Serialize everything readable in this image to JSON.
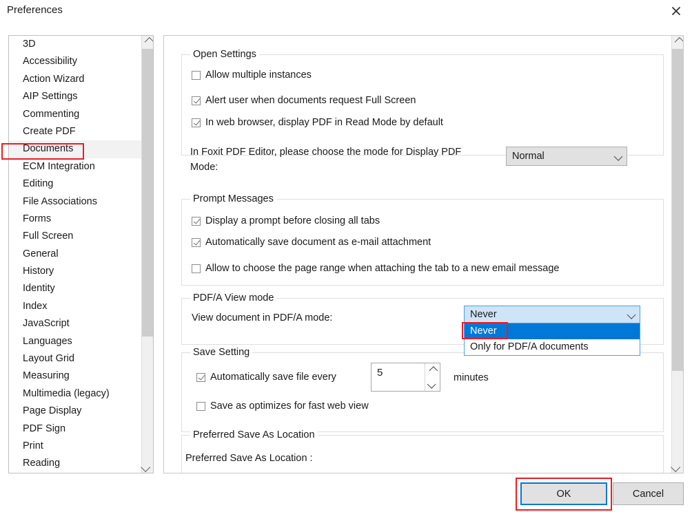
{
  "window": {
    "title": "Preferences",
    "close_icon": "close-icon"
  },
  "sidebar": {
    "items": [
      {
        "label": "3D",
        "selected": false
      },
      {
        "label": "Accessibility",
        "selected": false
      },
      {
        "label": "Action Wizard",
        "selected": false
      },
      {
        "label": "AIP Settings",
        "selected": false
      },
      {
        "label": "Commenting",
        "selected": false
      },
      {
        "label": "Create PDF",
        "selected": false
      },
      {
        "label": "Documents",
        "selected": true
      },
      {
        "label": "ECM Integration",
        "selected": false
      },
      {
        "label": "Editing",
        "selected": false
      },
      {
        "label": "File Associations",
        "selected": false
      },
      {
        "label": "Forms",
        "selected": false
      },
      {
        "label": "Full Screen",
        "selected": false
      },
      {
        "label": "General",
        "selected": false
      },
      {
        "label": "History",
        "selected": false
      },
      {
        "label": "Identity",
        "selected": false
      },
      {
        "label": "Index",
        "selected": false
      },
      {
        "label": "JavaScript",
        "selected": false
      },
      {
        "label": "Languages",
        "selected": false
      },
      {
        "label": "Layout Grid",
        "selected": false
      },
      {
        "label": "Measuring",
        "selected": false
      },
      {
        "label": "Multimedia (legacy)",
        "selected": false
      },
      {
        "label": "Page Display",
        "selected": false
      },
      {
        "label": "PDF Sign",
        "selected": false
      },
      {
        "label": "Print",
        "selected": false
      },
      {
        "label": "Reading",
        "selected": false
      }
    ],
    "scroll_up_icon": "chevron-up-icon",
    "scroll_down_icon": "chevron-down-icon"
  },
  "open_settings": {
    "legend": "Open Settings",
    "allow_multiple_instances": {
      "label": "Allow multiple instances",
      "checked": false
    },
    "alert_full_screen": {
      "label": "Alert user when documents request Full Screen",
      "checked": true
    },
    "read_mode_default": {
      "label": "In web browser, display PDF in Read Mode by default",
      "checked": true
    },
    "display_mode_label": "In Foxit PDF Editor, please choose the mode for Display PDF Mode:",
    "display_mode_value": "Normal",
    "display_mode_arrow_icon": "chevron-down-icon"
  },
  "prompt_messages": {
    "legend": "Prompt Messages",
    "closing_all_tabs": {
      "label": "Display a prompt before closing all tabs",
      "checked": true
    },
    "save_as_email_attachment": {
      "label": "Automatically save document as e-mail attachment",
      "checked": true
    },
    "choose_page_range": {
      "label": "Allow to choose the page range when attaching the tab to a new email message",
      "checked": false
    }
  },
  "pdfa_view_mode": {
    "legend": "PDF/A View mode",
    "label": "View document in PDF/A mode:",
    "value": "Never",
    "arrow_icon": "chevron-down-icon",
    "expanded": true,
    "options": [
      {
        "label": "Never",
        "selected": true
      },
      {
        "label": "Only for PDF/A documents",
        "selected": false
      }
    ]
  },
  "save_setting": {
    "legend": "Save Setting",
    "auto_save": {
      "label": "Automatically save file every",
      "checked": true
    },
    "interval_value": "5",
    "interval_unit": "minutes",
    "spinner_up_icon": "chevron-up-icon",
    "spinner_down_icon": "chevron-down-icon",
    "fast_web_view": {
      "label": "Save as optimizes for fast web view",
      "checked": false
    }
  },
  "preferred_save_location": {
    "legend": "Preferred Save As Location",
    "label": "Preferred Save As Location :"
  },
  "panel_scrollbar": {
    "scroll_up_icon": "chevron-up-icon",
    "scroll_down_icon": "chevron-down-icon"
  },
  "footer": {
    "ok_label": "OK",
    "cancel_label": "Cancel"
  },
  "annotations": {
    "accent_color": "#ee1b24",
    "focus_color": "#0078d7"
  }
}
